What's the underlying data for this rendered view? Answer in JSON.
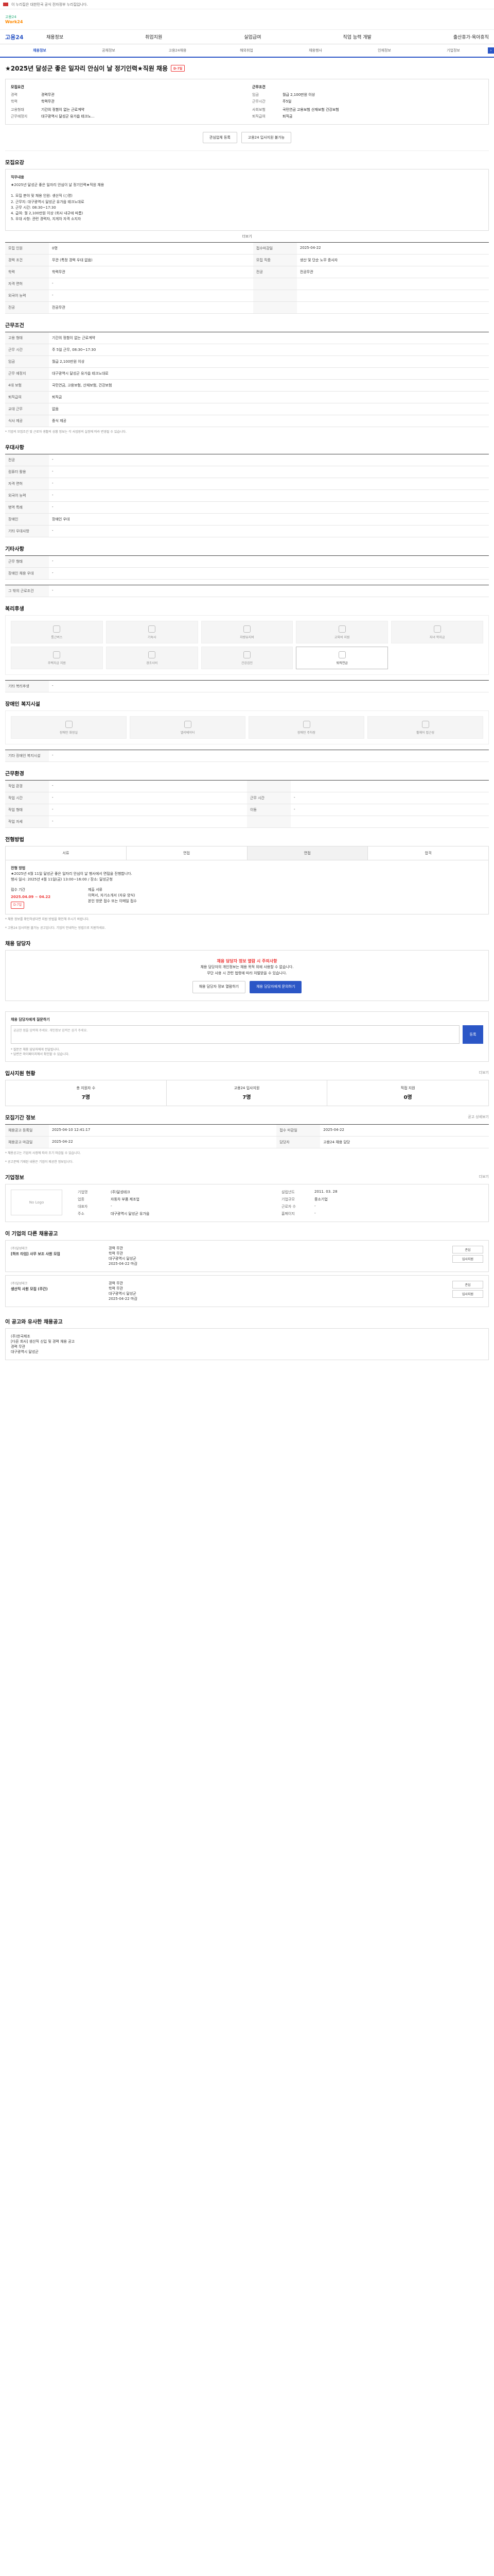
{
  "topbar": {
    "notice": "이 누리집은 대한민국 공식 전자정부 누리집입니다."
  },
  "header": {
    "logo_top": "고용24",
    "logo_bottom": "Work24"
  },
  "gnb": {
    "brand": "고용24",
    "menu": [
      "채용정보",
      "취업지원",
      "실업급여",
      "직업 능력 개발",
      "출산휴가·육아휴직"
    ]
  },
  "tabs": [
    "채용정보",
    "공채정보",
    "고용24채용",
    "해외취업",
    "채용행사",
    "인재정보",
    "기업정보"
  ],
  "job": {
    "title": "★2025년 달성군 좋은 일자리 안심이 날 정기인력★직원 채용",
    "badge": "D-7일",
    "company_hdr": "모집요건",
    "company_rows": [
      {
        "k": "경력",
        "v": "경력무관"
      },
      {
        "k": "학력",
        "v": "학력무관"
      },
      {
        "k": "",
        "v": ""
      },
      {
        "k": "고용형태",
        "v": "기간의 정함이 없는 근로계약"
      },
      {
        "k": "근무예정지",
        "v": "대구광역시 달성군 유가읍 테크노..."
      }
    ],
    "cond_hdr": "근무조건",
    "cond_rows": [
      {
        "k": "임금",
        "v": "월급 2,100만원 이상"
      },
      {
        "k": "근무시간",
        "v": "주5일"
      },
      {
        "k": "",
        "v": ""
      },
      {
        "k": "사회보험",
        "v": "국민연금 고용보험 산재보험 건강보험"
      },
      {
        "k": "퇴직급여",
        "v": "퇴직금"
      }
    ],
    "btn_scrap": "관심업체 등록",
    "btn_apply": "고용24 입사지원 불가능"
  },
  "recruit": {
    "title": "모집요강",
    "desc_title": "직무내용",
    "desc_lines": [
      "★2025년 달성군 좋은 일자리 안심이 날 정기인력★직원 채용",
      "",
      "1. 모집 분야 및 채용 인원: 생산직 (○명)",
      "2. 근무지: 대구광역시 달성군 유가읍 테크노대로",
      "3. 근무 시간: 08:30~17:30",
      "4. 급여: 월 2,100만원 이상 (회사 내규에 따름)",
      "5. 우대 사항: 관련 경력자, 지게차 자격 소지자"
    ],
    "more": "더보기",
    "rows": [
      {
        "k": "모집 인원",
        "v": "0명",
        "k2": "접수마감일",
        "v2": "2025-04-22"
      },
      {
        "k": "경력 조건",
        "v": "무관 (특정 경력 우대 없음)",
        "k2": "모집 직종",
        "v2": "생산 및 단순 노무 종사자"
      },
      {
        "k": "학력",
        "v": "학력무관",
        "k2": "전공",
        "v2": "전공무관"
      },
      {
        "k": "자격 면허",
        "v": "-",
        "k2": "",
        "v2": ""
      },
      {
        "k": "외국어 능력",
        "v": "-",
        "k2": "",
        "v2": ""
      },
      {
        "k": "전공",
        "v": "전공무관",
        "k2": "",
        "v2": ""
      }
    ]
  },
  "work": {
    "title": "근무조건",
    "rows": [
      {
        "k": "고용 형태",
        "v": "기간의 정함이 없는 근로계약"
      },
      {
        "k": "근무 시간",
        "v": "주 5일 근무, 08:30~17:30"
      },
      {
        "k": "임금",
        "v": "월급 2,100만원 이상"
      },
      {
        "k": "근무 예정지",
        "v": "대구광역시 달성군 유가읍 테크노대로"
      },
      {
        "k": "4대 보험",
        "v": "국민연금, 고용보험, 산재보험, 건강보험"
      },
      {
        "k": "퇴직급여",
        "v": "퇴직금"
      },
      {
        "k": "교대 근무",
        "v": "없음"
      },
      {
        "k": "식사 제공",
        "v": "중식 제공"
      }
    ],
    "note": "* 기업의 모집조건 및 근로자 생활의 상황 정보는 각 사업장의 실정에 따라 변경될 수 있습니다."
  },
  "prefer": {
    "title": "우대사항",
    "rows": [
      {
        "k": "전공",
        "v": "-"
      },
      {
        "k": "컴퓨터 활용",
        "v": "-"
      },
      {
        "k": "자격 면허",
        "v": "-"
      },
      {
        "k": "외국어 능력",
        "v": "-"
      },
      {
        "k": "병역 특례",
        "v": "-"
      },
      {
        "k": "장애인",
        "v": "장애인 우대"
      },
      {
        "k": "기타 우대사항",
        "v": "-"
      }
    ]
  },
  "docs": {
    "title": "기타사항",
    "rows": [
      {
        "k": "근무 형태",
        "v": "-"
      },
      {
        "k": "장애인 채용 우대",
        "v": "-"
      }
    ],
    "more_title": "그 밖의 근로조건",
    "more_value": "-"
  },
  "welfare": {
    "title": "복리후생",
    "items": [
      {
        "label": "통근버스",
        "active": false
      },
      {
        "label": "기숙사",
        "active": false
      },
      {
        "label": "차량유지비",
        "active": false
      },
      {
        "label": "교육비 지원",
        "active": false
      },
      {
        "label": "자녀 학자금",
        "active": false
      },
      {
        "label": "주택자금 지원",
        "active": false
      },
      {
        "label": "경조사비",
        "active": false
      },
      {
        "label": "건강검진",
        "active": false
      },
      {
        "label": "퇴직연금",
        "active": true
      }
    ],
    "etc_title": "기타 복리후생",
    "etc_value": "-"
  },
  "disab": {
    "title": "장애인 복지시설",
    "items": [
      {
        "label": "장애인 화장실"
      },
      {
        "label": "엘리베이터"
      },
      {
        "label": "장애인 주차장"
      },
      {
        "label": "휠체어 접근성"
      }
    ],
    "etc_title": "기타 장애인 복지시설",
    "etc_value": "-"
  },
  "worktype": {
    "title": "근무환경",
    "rows": [
      {
        "k": "작업 환경",
        "v": "-",
        "k2": "",
        "v2": ""
      },
      {
        "k": "작업 시간",
        "v": "-",
        "k2": "근무 시간",
        "v2": "-"
      },
      {
        "k": "작업 형태",
        "v": "-",
        "k2": "이동",
        "v2": "-"
      },
      {
        "k": "작업 자세",
        "v": "-",
        "k2": "",
        "v2": ""
      }
    ]
  },
  "process": {
    "title": "전형방법",
    "tabs": [
      "서류",
      "면접",
      "면접",
      "합격"
    ],
    "detail_title": "전형 방법",
    "detail_lines": [
      "★2025년 4월 11일 달성군 좋은 일자리 안심이 날 행사에서 면접을 진행합니다.",
      "행사 일시: 2025년 4월 11일(금) 13:00~16:00 / 장소: 달성군청"
    ],
    "period_label": "접수 기간",
    "period": "2025.04.09 ~ 04.22",
    "badge": "D-7일",
    "submit_label": "제출 서류",
    "submit_lines": [
      "이력서, 자기소개서 (자유 양식)",
      "본인 방문 접수 또는 이메일 접수"
    ],
    "notes": [
      "* 채용 정보를 확인하셨다면 지원 방법을 확인해 주시기 바랍니다.",
      "* 고용24 입사지원 불가능 공고입니다. 기업이 안내하는 방법으로 지원하세요."
    ]
  },
  "contact": {
    "title": "채용 담당자",
    "warn": "채용 담당자 정보 열람 시 주의사항",
    "lines": [
      "채용 담당자의 개인정보는 채용 목적 외에 사용할 수 없습니다.",
      "무단 사용 시 관련 법령에 따라 처벌받을 수 있습니다."
    ],
    "btn_1": "채용 담당자 정보 열람하기",
    "btn_2": "채용 담당자에게 문의하기"
  },
  "qa": {
    "title": "채용 담당자에게 질문하기",
    "placeholder": "궁금한 점을 입력해 주세요. 개인정보 입력은 삼가 주세요.",
    "btn": "등록",
    "notes": [
      "* 질문은 채용 담당자에게 전달됩니다.",
      "* 답변은 마이페이지에서 확인할 수 있습니다."
    ]
  },
  "applicants": {
    "title": "입사지원 현황",
    "more": "더보기",
    "stats": [
      {
        "label": "총 지원자 수",
        "value": "7명"
      },
      {
        "label": "고용24 입사지원",
        "value": "7명"
      },
      {
        "label": "직접 지원",
        "value": "0명"
      }
    ]
  },
  "period": {
    "title": "모집기간 정보",
    "more": "공고 상세보기",
    "rows": [
      {
        "k": "채용공고 등록일",
        "v": "2025-04-10 12:41:17",
        "k2": "접수 마감일",
        "v2": "2025-04-22"
      },
      {
        "k": "채용공고 마감일",
        "v": "2025-04-22",
        "k2": "담당자",
        "v2": "고용24 채용 담당"
      }
    ],
    "notes": [
      "* 채용공고는 기업의 사정에 따라 조기 마감될 수 있습니다.",
      "* 공고문에 기재된 내용은 기업이 제공한 정보입니다."
    ]
  },
  "company": {
    "title": "기업정보",
    "more": "더보기",
    "logo": "No Logo",
    "rows": [
      {
        "k": "기업명",
        "v": "(주)달성테크",
        "k2": "설립년도",
        "v2": "2011. 03. 28"
      },
      {
        "k": "업종",
        "v": "자동차 부품 제조업",
        "k2": "기업규모",
        "v2": "중소기업"
      },
      {
        "k": "대표자",
        "v": "-",
        "k2": "근로자 수",
        "v2": "-"
      },
      {
        "k": "주소",
        "v": "대구광역시 달성군 유가읍",
        "k2": "홈페이지",
        "v2": "-"
      }
    ]
  },
  "related": {
    "title": "이 기업의 다른 채용공고",
    "items": [
      {
        "company": "(주)달성테크",
        "title": "[하프 타임] 사무 보조 사원 모집",
        "a": "경력 무관",
        "b": "학력 무관",
        "c": "대구광역시 달성군",
        "d": "2025-04-22 마감",
        "btn1": "관심",
        "btn2": "입사지원"
      },
      {
        "company": "(주)달성테크",
        "title": "생산직 사원 모집 (주간)",
        "a": "경력 무관",
        "b": "학력 무관",
        "c": "대구광역시 달성군",
        "d": "2025-04-22 마감",
        "btn1": "관심",
        "btn2": "입사지원"
      }
    ]
  },
  "recommend": {
    "title": "이 공고와 유사한 채용공고",
    "items": [
      {
        "company": "(주)한국제조",
        "title": "[다른 회사] 생산직 신입 및 경력 채용 공고",
        "a": "경력 무관",
        "b": "대구광역시 달성군"
      }
    ]
  }
}
